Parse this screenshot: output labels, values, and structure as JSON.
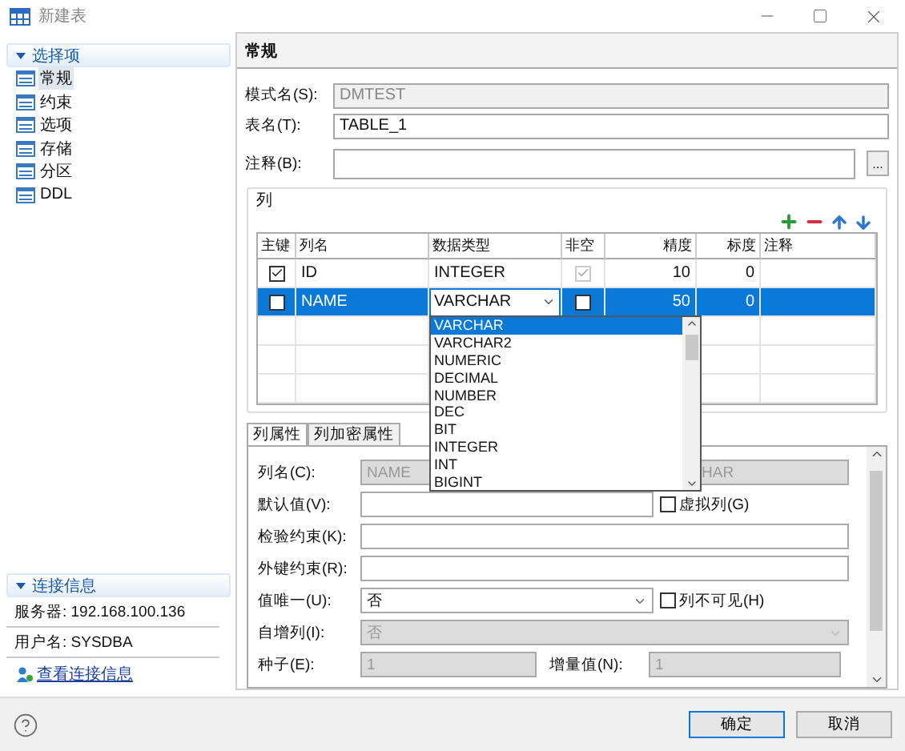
{
  "window": {
    "title": "新建表"
  },
  "sidebar": {
    "title": "选择项",
    "expanded": true,
    "items": [
      {
        "label": "常规",
        "selected": true
      },
      {
        "label": "约束",
        "selected": false
      },
      {
        "label": "选项",
        "selected": false
      },
      {
        "label": "存储",
        "selected": false
      },
      {
        "label": "分区",
        "selected": false
      },
      {
        "label": "DDL",
        "selected": false
      }
    ]
  },
  "connection": {
    "title": "连接信息",
    "expanded": true,
    "lines": [
      "服务器: 192.168.100.136",
      "用户名: SYSDBA"
    ],
    "link": "查看连接信息"
  },
  "page": {
    "title": "常规",
    "fields": [
      {
        "label": "模式名(S):",
        "value": "DMTEST",
        "disabled": true,
        "browse": false
      },
      {
        "label": "表名(T):",
        "value": "TABLE_1",
        "disabled": false,
        "browse": false
      },
      {
        "label": "注释(B):",
        "disabled": false,
        "browse": true,
        "browse_label": "..."
      }
    ]
  },
  "columns_group": {
    "title": "列",
    "table": {
      "columns": [
        "主键",
        "列名",
        "数据类型",
        "非空",
        "精度",
        "标度",
        "注释"
      ],
      "rows": [
        {
          "primary_key": true,
          "name": "ID",
          "type": "INTEGER",
          "not_null": true,
          "not_null_disabled": true,
          "precision": "10",
          "scale": "0",
          "selected": false,
          "editing": false
        },
        {
          "primary_key": false,
          "name": "NAME",
          "type": "VARCHAR",
          "not_null": false,
          "not_null_disabled": false,
          "precision": "50",
          "scale": "0",
          "selected": true,
          "editing": true
        }
      ]
    }
  },
  "type_dropdown": {
    "options": [
      {
        "label": "VARCHAR",
        "selected": true
      },
      {
        "label": "VARCHAR2",
        "selected": false
      },
      {
        "label": "NUMERIC",
        "selected": false
      },
      {
        "label": "DECIMAL",
        "selected": false
      },
      {
        "label": "NUMBER",
        "selected": false
      },
      {
        "label": "DEC",
        "selected": false
      },
      {
        "label": "BIT",
        "selected": false
      },
      {
        "label": "INTEGER",
        "selected": false
      },
      {
        "label": "INT",
        "selected": false
      },
      {
        "label": "BIGINT",
        "selected": false
      }
    ]
  },
  "property_tabs": [
    {
      "label": "列属性",
      "selected": true
    },
    {
      "label": "列加密属性",
      "selected": false
    }
  ],
  "properties": [
    {
      "kind": "text",
      "label": "列名(C):",
      "value": "NAME",
      "disabled": true,
      "side_value": "HAR"
    },
    {
      "kind": "text",
      "label": "默认值(V):",
      "disabled": false,
      "checkbox": {
        "label": "虚拟列(G)",
        "checked": false
      }
    },
    {
      "kind": "text",
      "label": "检验约束(K):",
      "disabled": false
    },
    {
      "kind": "text",
      "label": "外键约束(R):",
      "disabled": false
    },
    {
      "kind": "select",
      "label": "值唯一(U):",
      "value": "否",
      "disabled": false,
      "checkbox": {
        "label": "列不可见(H)",
        "checked": false
      }
    },
    {
      "kind": "select",
      "label": "自增列(I):",
      "value": "否",
      "disabled": true
    },
    {
      "kind": "pair",
      "label": "种子(E):",
      "value": "1",
      "disabled": true,
      "side_label": "增量值(N):",
      "side_value": "1"
    }
  ],
  "buttons": [
    {
      "label": "确定",
      "default": true
    },
    {
      "label": "取消",
      "default": false
    }
  ]
}
